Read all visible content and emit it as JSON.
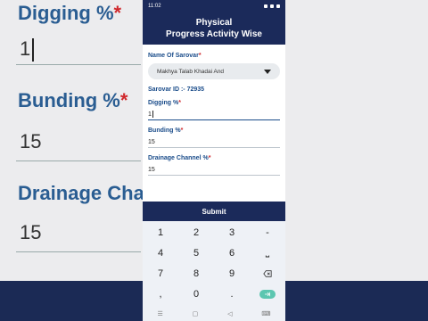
{
  "status_bar": {
    "time": "11:02"
  },
  "header": {
    "title_line1": "Physical",
    "title_line2": "Progress Activity Wise"
  },
  "form": {
    "sarovar_name_label": "Name Of Sarovar",
    "sarovar_name_value": "Makhya Talab Khadai And",
    "sarovar_id_text": "Sarovar ID :- 72935",
    "digging_label": "Digging %",
    "digging_value": "1",
    "bunding_label": "Bunding %",
    "bunding_value": "15",
    "drainage_label": "Drainage Channel %",
    "drainage_value": "15",
    "required_mark": "*"
  },
  "submit_label": "Submit",
  "keypad": {
    "row1": [
      "1",
      "2",
      "3",
      "-"
    ],
    "row2": [
      "4",
      "5",
      "6",
      "⎵"
    ],
    "row3": [
      "7",
      "8",
      "9"
    ],
    "row4": [
      ",",
      "0",
      "."
    ]
  },
  "background": {
    "label_digging": "Digging %",
    "label_bunding": "Bunding %",
    "label_drainage": "Drainage Cha",
    "value_digging": "1",
    "value_bunding": "15",
    "value_drainage": "15",
    "required_mark": "*"
  }
}
